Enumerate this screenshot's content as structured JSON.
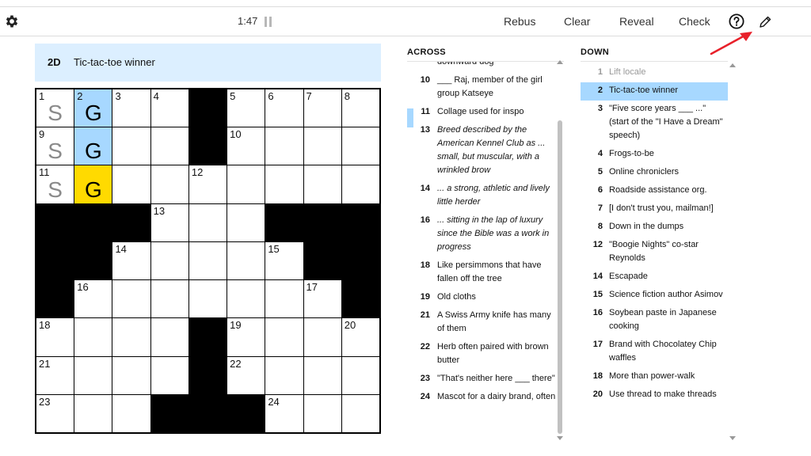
{
  "toolbar": {
    "timer": "1:47",
    "buttons": [
      "Rebus",
      "Clear",
      "Reveal",
      "Check"
    ],
    "icons": [
      "gear-icon",
      "pause-icon",
      "help-icon",
      "pencil-icon"
    ]
  },
  "current_clue": {
    "number": "2D",
    "text": "Tic-tac-toe winner"
  },
  "grid": {
    "rows": 9,
    "cols": 9,
    "black": [
      "0,4",
      "1,4",
      "3,0",
      "3,1",
      "3,2",
      "3,6",
      "3,7",
      "3,8",
      "4,0",
      "4,1",
      "4,7",
      "4,8",
      "5,0",
      "5,8",
      "6,4",
      "7,4",
      "8,3",
      "8,4",
      "8,5"
    ],
    "numbers": {
      "0,0": "1",
      "0,1": "2",
      "0,2": "3",
      "0,3": "4",
      "0,5": "5",
      "0,6": "6",
      "0,7": "7",
      "0,8": "8",
      "1,0": "9",
      "1,5": "10",
      "2,0": "11",
      "2,4": "12",
      "3,3": "13",
      "4,2": "14",
      "4,6": "15",
      "5,1": "16",
      "5,7": "17",
      "6,0": "18",
      "6,5": "19",
      "6,8": "20",
      "7,0": "21",
      "7,5": "22",
      "8,0": "23",
      "8,6": "24"
    },
    "letters": {
      "0,0": {
        "char": "S",
        "style": "gray"
      },
      "1,0": {
        "char": "S",
        "style": "gray"
      },
      "2,0": {
        "char": "S",
        "style": "gray"
      },
      "0,1": {
        "char": "G",
        "style": "pen"
      },
      "1,1": {
        "char": "G",
        "style": "pen"
      },
      "2,1": {
        "char": "G",
        "style": "pen"
      }
    },
    "word_cells": [
      "0,1",
      "1,1"
    ],
    "selected_cell": "2,1"
  },
  "across": {
    "heading": "ACROSS",
    "clues": [
      {
        "number": "",
        "text": "downward dog",
        "italic": false
      },
      {
        "number": "10",
        "text": "___ Raj, member of the girl group Katseye",
        "italic": false
      },
      {
        "number": "11",
        "text": "Collage used for inspo",
        "italic": false,
        "word": true
      },
      {
        "number": "13",
        "text": "Breed described by the American Kennel Club as ... small, but muscular, with a wrinkled brow",
        "italic": true
      },
      {
        "number": "14",
        "text": "... a strong, athletic and lively little herder",
        "italic": true
      },
      {
        "number": "16",
        "text": "... sitting in the lap of luxury since the Bible was a work in progress",
        "italic": true
      },
      {
        "number": "18",
        "text": "Like persimmons that have fallen off the tree",
        "italic": false
      },
      {
        "number": "19",
        "text": "Old cloths",
        "italic": false
      },
      {
        "number": "21",
        "text": "A Swiss Army knife has many of them",
        "italic": false
      },
      {
        "number": "22",
        "text": "Herb often paired with brown butter",
        "italic": false
      },
      {
        "number": "23",
        "text": "\"That's neither here ___ there\"",
        "italic": false
      },
      {
        "number": "24",
        "text": "Mascot for a dairy brand, often",
        "italic": false
      }
    ]
  },
  "down": {
    "heading": "DOWN",
    "clues": [
      {
        "number": "1",
        "text": "Lift locale",
        "muted": true
      },
      {
        "number": "2",
        "text": "Tic-tac-toe winner",
        "active": true
      },
      {
        "number": "3",
        "text": "\"Five score years ___ ...\" (start of the \"I Have a Dream\" speech)"
      },
      {
        "number": "4",
        "text": "Frogs-to-be"
      },
      {
        "number": "5",
        "text": "Online chroniclers"
      },
      {
        "number": "6",
        "text": "Roadside assistance org."
      },
      {
        "number": "7",
        "text": "[I don't trust you, mailman!]"
      },
      {
        "number": "8",
        "text": "Down in the dumps"
      },
      {
        "number": "12",
        "text": "\"Boogie Nights\" co-star Reynolds"
      },
      {
        "number": "14",
        "text": "Escapade"
      },
      {
        "number": "15",
        "text": "Science fiction author Asimov"
      },
      {
        "number": "16",
        "text": "Soybean paste in Japanese cooking"
      },
      {
        "number": "17",
        "text": "Brand with Chocolatey Chip waffles"
      },
      {
        "number": "18",
        "text": "More than power-walk"
      },
      {
        "number": "20",
        "text": "Use thread to make threads"
      }
    ]
  },
  "colors": {
    "selected_cell": "#ffda00",
    "word_highlight": "#a7d8ff",
    "clue_bar": "#dcefff",
    "annotation_arrow": "#e8202a"
  }
}
